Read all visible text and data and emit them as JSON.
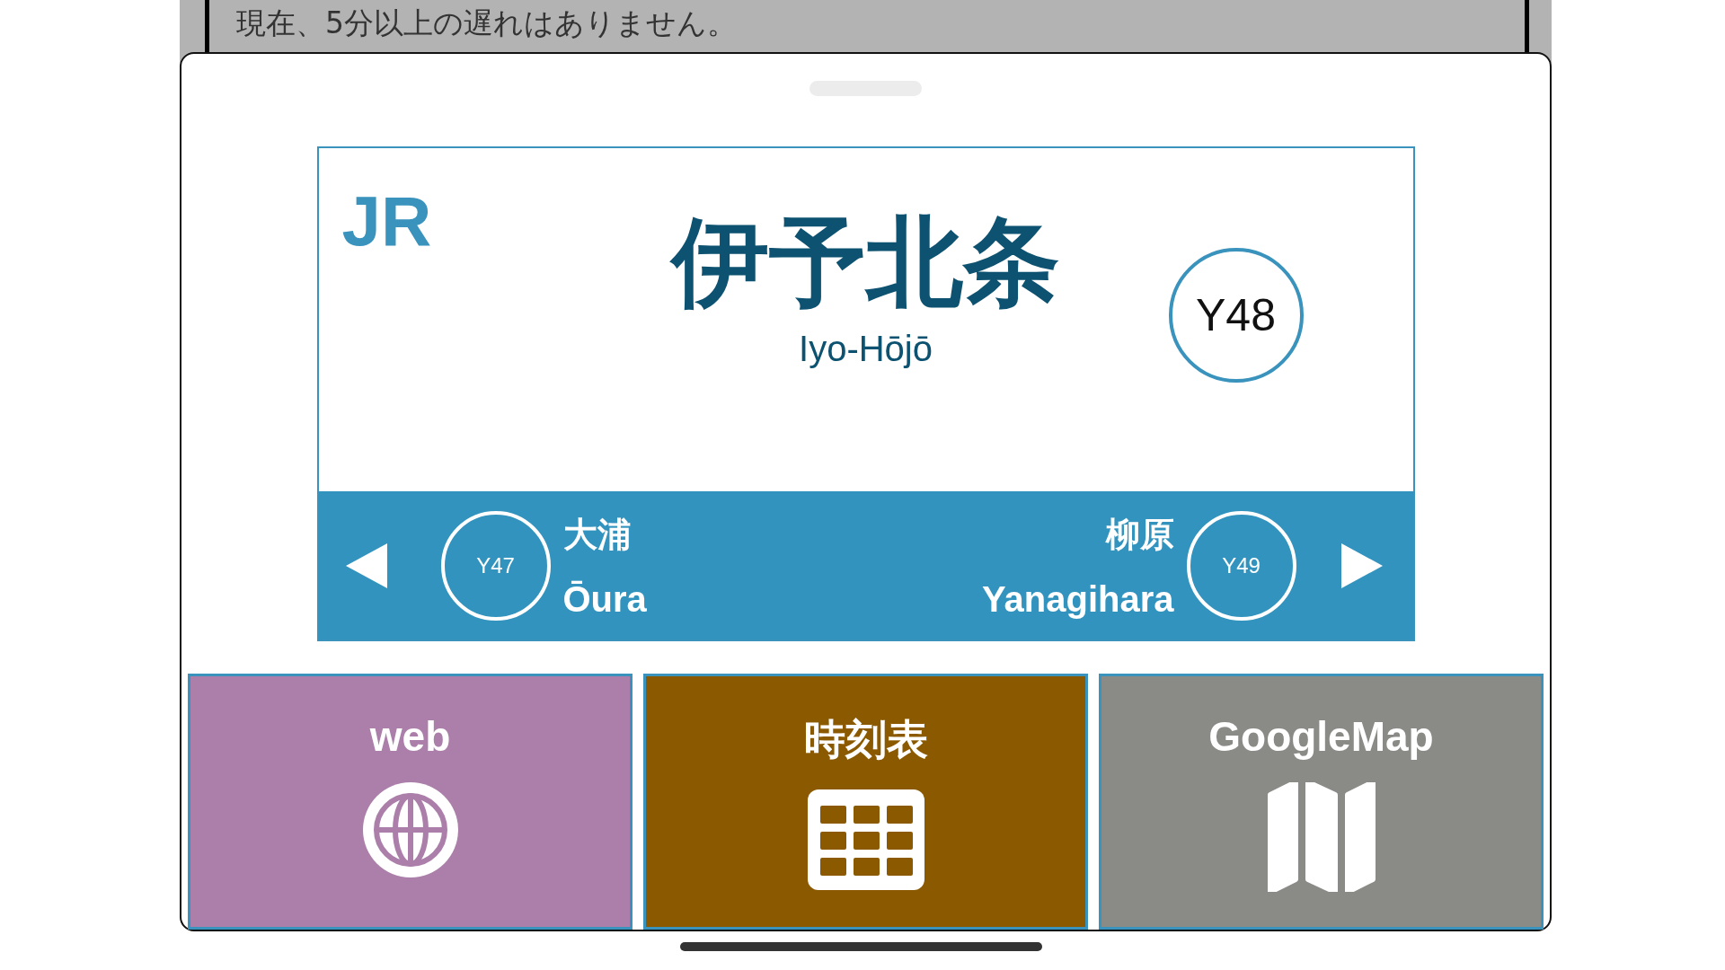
{
  "notice": "現在、5分以上の遅れはありません。",
  "station_sign": {
    "operator": "JR",
    "name_ja": "伊予北条",
    "name_en": "Iyo-Hōjō",
    "number": "Y48",
    "previous": {
      "number": "Y47",
      "name_ja": "大浦",
      "name_en": "Ōura"
    },
    "next": {
      "number": "Y49",
      "name_ja": "柳原",
      "name_en": "Yanagihara"
    }
  },
  "tiles": [
    {
      "label": "web",
      "kind": "globe",
      "color": "#ab7faa"
    },
    {
      "label": "時刻表",
      "kind": "table",
      "color": "#8b5a00"
    },
    {
      "label": "GoogleMap",
      "kind": "map",
      "color": "#8a8b87"
    }
  ]
}
